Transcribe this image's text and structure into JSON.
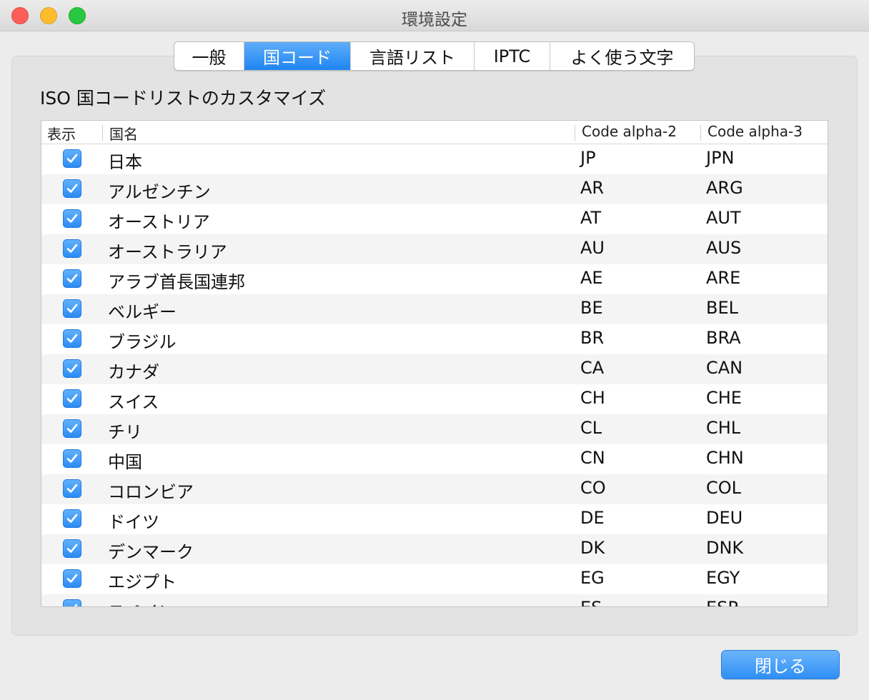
{
  "window": {
    "title": "環境設定"
  },
  "tabs": [
    {
      "label": "一般",
      "active": false
    },
    {
      "label": "国コード",
      "active": true
    },
    {
      "label": "言語リスト",
      "active": false
    },
    {
      "label": "IPTC",
      "active": false
    },
    {
      "label": "よく使う文字",
      "active": false
    }
  ],
  "section_title": "ISO 国コードリストのカスタマイズ",
  "table": {
    "columns": {
      "show": "表示",
      "name": "国名",
      "alpha2": "Code alpha-2",
      "alpha3": "Code alpha-3"
    },
    "rows": [
      {
        "checked": true,
        "name": "日本",
        "alpha2": "JP",
        "alpha3": "JPN"
      },
      {
        "checked": true,
        "name": "アルゼンチン",
        "alpha2": "AR",
        "alpha3": "ARG"
      },
      {
        "checked": true,
        "name": "オーストリア",
        "alpha2": "AT",
        "alpha3": "AUT"
      },
      {
        "checked": true,
        "name": "オーストラリア",
        "alpha2": "AU",
        "alpha3": "AUS"
      },
      {
        "checked": true,
        "name": "アラブ首長国連邦",
        "alpha2": "AE",
        "alpha3": "ARE"
      },
      {
        "checked": true,
        "name": "ベルギー",
        "alpha2": "BE",
        "alpha3": "BEL"
      },
      {
        "checked": true,
        "name": "ブラジル",
        "alpha2": "BR",
        "alpha3": "BRA"
      },
      {
        "checked": true,
        "name": "カナダ",
        "alpha2": "CA",
        "alpha3": "CAN"
      },
      {
        "checked": true,
        "name": "スイス",
        "alpha2": "CH",
        "alpha3": "CHE"
      },
      {
        "checked": true,
        "name": "チリ",
        "alpha2": "CL",
        "alpha3": "CHL"
      },
      {
        "checked": true,
        "name": "中国",
        "alpha2": "CN",
        "alpha3": "CHN"
      },
      {
        "checked": true,
        "name": "コロンビア",
        "alpha2": "CO",
        "alpha3": "COL"
      },
      {
        "checked": true,
        "name": "ドイツ",
        "alpha2": "DE",
        "alpha3": "DEU"
      },
      {
        "checked": true,
        "name": "デンマーク",
        "alpha2": "DK",
        "alpha3": "DNK"
      },
      {
        "checked": true,
        "name": "エジプト",
        "alpha2": "EG",
        "alpha3": "EGY"
      },
      {
        "checked": true,
        "name": "スペイン",
        "alpha2": "ES",
        "alpha3": "ESP"
      }
    ]
  },
  "buttons": {
    "close": "閉じる"
  },
  "icons": {
    "checkbox": "checkmark-icon"
  },
  "colors": {
    "accent": "#2a8cf4",
    "row_alt": "#f4f4f4"
  }
}
